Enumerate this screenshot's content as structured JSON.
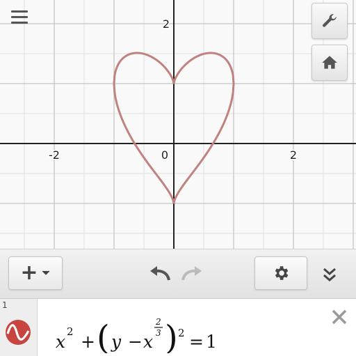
{
  "graph": {
    "x_tick_labels": [
      "-2",
      "0",
      "2"
    ],
    "y_tick_labels": [
      "2"
    ],
    "curve_color": "#c0827f",
    "curve_equation": "x^2 + (y - x^(2/3))^2 = 1"
  },
  "menu": {
    "icon": "hamburger-menu-icon"
  },
  "corner_buttons": [
    {
      "name": "settings-wrench",
      "icon": "wrench-icon"
    },
    {
      "name": "home",
      "icon": "home-icon"
    }
  ],
  "toolbar": {
    "add_label": "+",
    "add_icon": "plus-dropdown-icon",
    "undo_icon": "undo-icon",
    "redo_icon": "redo-icon",
    "settings_icon": "gear-icon",
    "collapse_icon": "double-chevron-down-icon"
  },
  "expression": {
    "index": "1",
    "icon": "desmos-wave-icon",
    "icon_color": "#c74440",
    "parts": {
      "x": "x",
      "sq1": "2",
      "plus": "+",
      "lparen": "(",
      "y": "y",
      "minus": "−",
      "x2": "x",
      "exp_num": "2",
      "exp_den": "3",
      "rparen": ")",
      "sq2": "2",
      "eq": "=",
      "one": "1"
    },
    "delete_icon": "close-x-icon"
  }
}
